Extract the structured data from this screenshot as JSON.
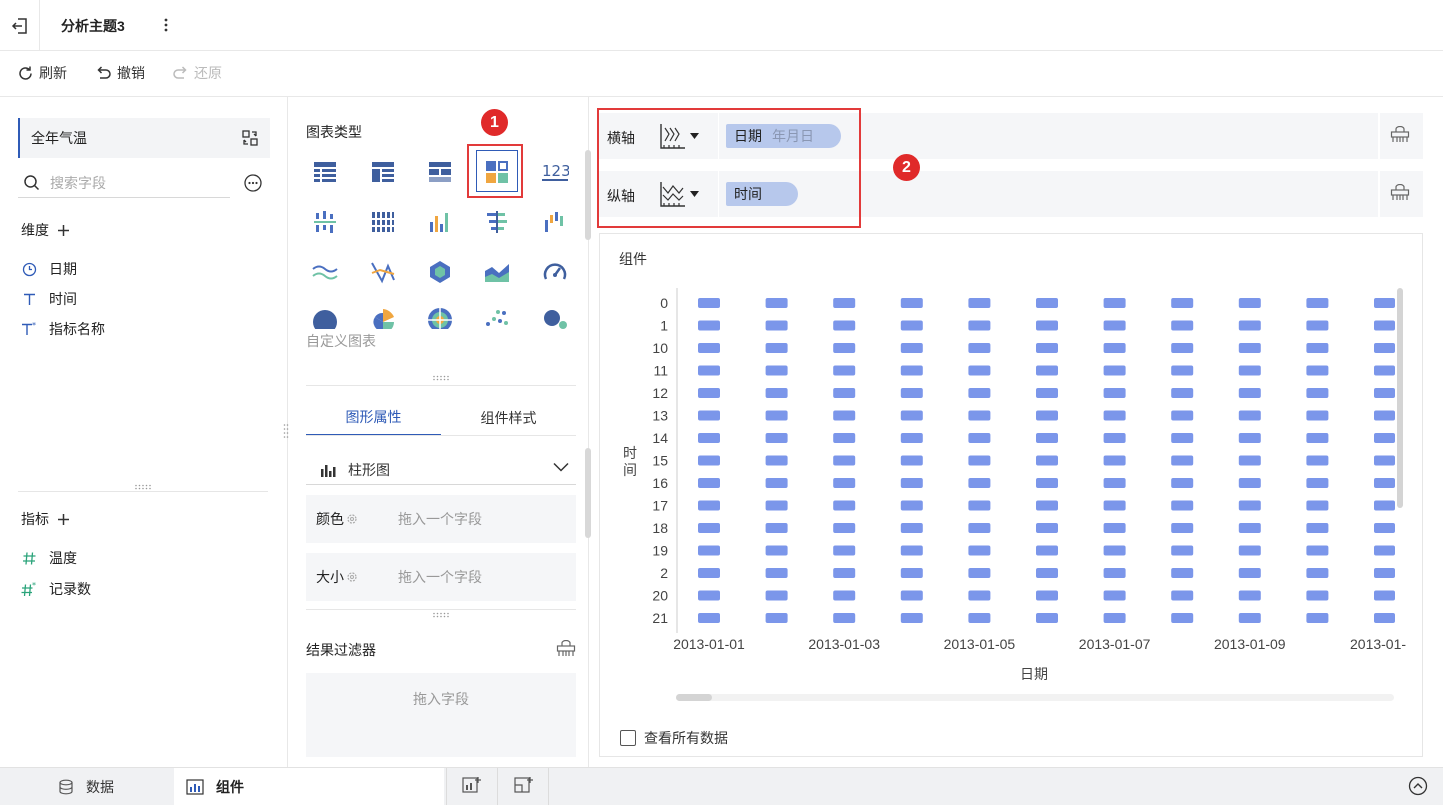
{
  "header": {
    "title": "分析主题3"
  },
  "toolbar": {
    "refresh": "刷新",
    "undo": "撤销",
    "redo": "还原"
  },
  "left": {
    "dataset_name": "全年气温",
    "search_placeholder": "搜索字段",
    "dimensions_label": "维度",
    "dimensions": [
      {
        "icon": "clock-icon",
        "label": "日期"
      },
      {
        "icon": "text-type-icon",
        "label": "时间"
      },
      {
        "icon": "text-calc-icon",
        "label": "指标名称"
      }
    ],
    "measures_label": "指标",
    "measures": [
      {
        "icon": "number-icon",
        "label": "温度"
      },
      {
        "icon": "number-calc-icon",
        "label": "记录数"
      }
    ]
  },
  "middle": {
    "chart_type_label": "图表类型",
    "custom_chart_label": "自定义图表",
    "tabs": [
      "图形属性",
      "组件样式"
    ],
    "shape_type": "柱形图",
    "props": [
      {
        "label": "颜色",
        "placeholder": "拖入一个字段"
      },
      {
        "label": "大小",
        "placeholder": "拖入一个字段"
      }
    ],
    "filter_label": "结果过滤器",
    "filter_placeholder": "拖入字段",
    "badge1": "1"
  },
  "axes": {
    "x_label": "横轴",
    "y_label": "纵轴",
    "x_field": "日期",
    "x_field_sub": "年月日",
    "y_field": "时间",
    "badge2": "2"
  },
  "chart_data": {
    "type": "heatmap",
    "title": "组件",
    "xlabel": "日期",
    "ylabel": "时间",
    "x_ticks": [
      "2013-01-01",
      "2013-01-03",
      "2013-01-05",
      "2013-01-07",
      "2013-01-09",
      "2013-01-"
    ],
    "y_categories": [
      "0",
      "1",
      "10",
      "11",
      "12",
      "13",
      "14",
      "15",
      "16",
      "17",
      "18",
      "19",
      "2",
      "20",
      "21"
    ],
    "columns": 11,
    "color": "#7b96ea"
  },
  "chart_footer": {
    "view_all": "查看所有数据"
  },
  "bottom": {
    "tab_data": "数据",
    "tab_widget": "组件"
  }
}
